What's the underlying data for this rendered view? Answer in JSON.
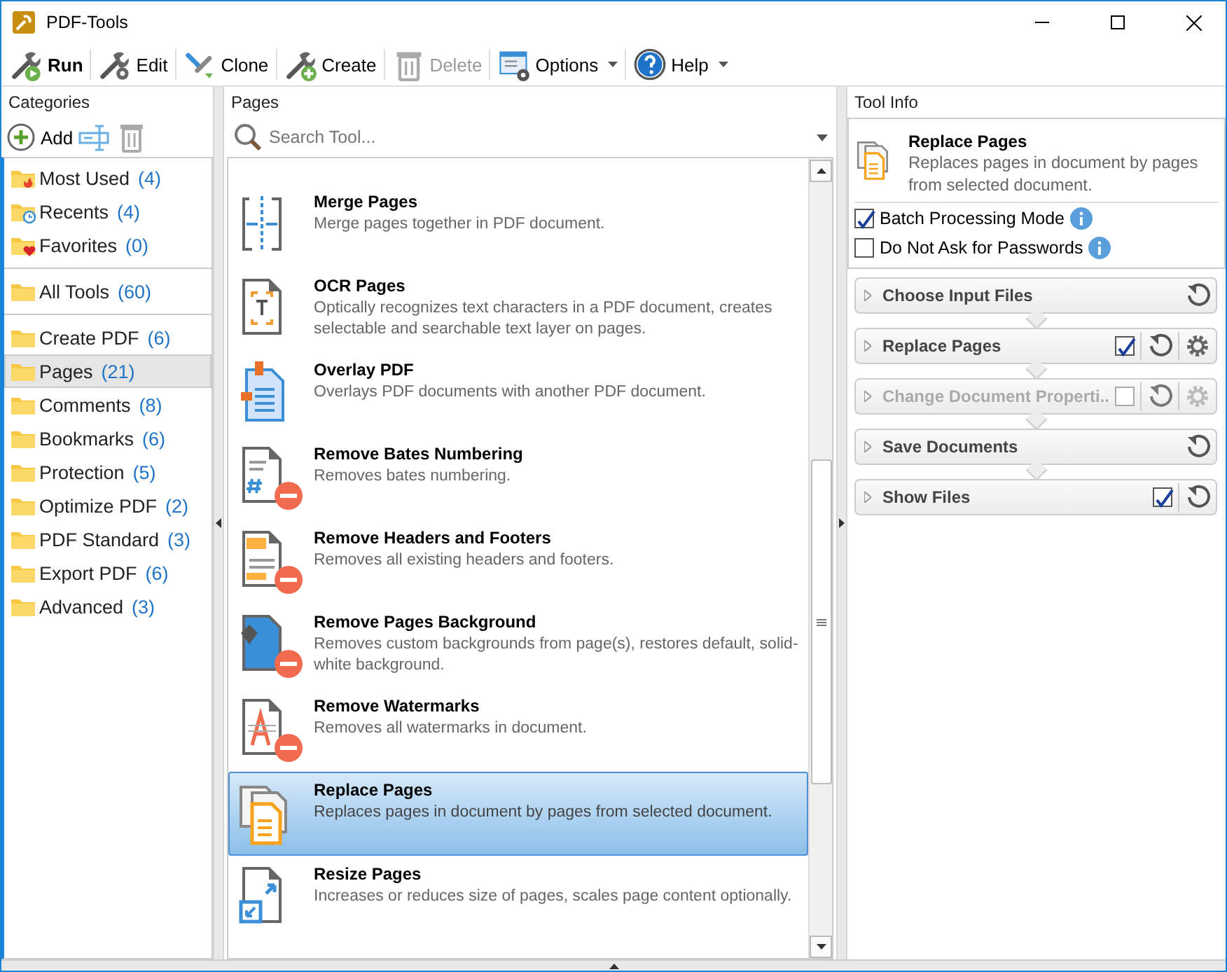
{
  "window": {
    "title": "PDF-Tools"
  },
  "toolbar": [
    {
      "label": "Run",
      "kind": "run",
      "disabled": false,
      "dropdown": false
    },
    {
      "label": "Edit",
      "kind": "edit",
      "disabled": false,
      "dropdown": false
    },
    {
      "label": "Clone",
      "kind": "clone",
      "disabled": false,
      "dropdown": false
    },
    {
      "label": "Create",
      "kind": "create",
      "disabled": false,
      "dropdown": false
    },
    {
      "label": "Delete",
      "kind": "delete",
      "disabled": true,
      "dropdown": false
    },
    {
      "label": "Options",
      "kind": "options",
      "disabled": false,
      "dropdown": true
    },
    {
      "label": "Help",
      "kind": "help",
      "disabled": false,
      "dropdown": true
    }
  ],
  "categories": {
    "title": "Categories",
    "add_label": "Add",
    "groups": [
      [
        {
          "label": "Most Used",
          "count": "(4)",
          "kind": "fire",
          "selected": false
        },
        {
          "label": "Recents",
          "count": "(4)",
          "kind": "clock",
          "selected": false
        },
        {
          "label": "Favorites",
          "count": "(0)",
          "kind": "heart",
          "selected": false
        }
      ],
      [
        {
          "label": "All Tools",
          "count": "(60)",
          "kind": "folder",
          "selected": false
        }
      ],
      [
        {
          "label": "Create PDF",
          "count": "(6)",
          "kind": "folder",
          "selected": false
        },
        {
          "label": "Pages",
          "count": "(21)",
          "kind": "folder",
          "selected": true
        },
        {
          "label": "Comments",
          "count": "(8)",
          "kind": "folder",
          "selected": false
        },
        {
          "label": "Bookmarks",
          "count": "(6)",
          "kind": "folder",
          "selected": false
        },
        {
          "label": "Protection",
          "count": "(5)",
          "kind": "folder",
          "selected": false
        },
        {
          "label": "Optimize PDF",
          "count": "(2)",
          "kind": "folder",
          "selected": false
        },
        {
          "label": "PDF Standard",
          "count": "(3)",
          "kind": "folder",
          "selected": false
        },
        {
          "label": "Export PDF",
          "count": "(6)",
          "kind": "folder",
          "selected": false
        },
        {
          "label": "Advanced",
          "count": "(3)",
          "kind": "folder",
          "selected": false
        }
      ]
    ]
  },
  "pages": {
    "title": "Pages",
    "search": {
      "placeholder": "Search Tool..."
    },
    "tools": [
      {
        "name": "Merge Pages",
        "description": "Merge pages together in PDF document.",
        "selected": false
      },
      {
        "name": "OCR Pages",
        "description": "Optically recognizes text characters in a PDF document, creates selectable and searchable text layer on pages.",
        "selected": false
      },
      {
        "name": "Overlay PDF",
        "description": "Overlays PDF documents with another PDF document.",
        "selected": false
      },
      {
        "name": "Remove Bates Numbering",
        "description": "Removes bates numbering.",
        "selected": false
      },
      {
        "name": "Remove Headers and Footers",
        "description": "Removes all existing headers and footers.",
        "selected": false
      },
      {
        "name": "Remove Pages Background",
        "description": "Removes custom backgrounds from page(s), restores default, solid-white background.",
        "selected": false
      },
      {
        "name": "Remove Watermarks",
        "description": "Removes all watermarks in document.",
        "selected": false
      },
      {
        "name": "Replace Pages",
        "description": "Replaces pages in document by pages from selected document.",
        "selected": true
      },
      {
        "name": "Resize Pages",
        "description": "Increases or reduces size of pages, scales page content optionally.",
        "selected": false
      }
    ]
  },
  "tool_info": {
    "title": "Tool Info",
    "name": "Replace Pages",
    "description": "Replaces pages in document by pages from selected document.",
    "options": [
      {
        "label": "Batch Processing Mode",
        "checked": true
      },
      {
        "label": "Do Not Ask for Passwords",
        "checked": false
      }
    ],
    "steps": [
      {
        "label": "Choose Input Files",
        "kind": "plain",
        "disabled": false
      },
      {
        "label": "Replace Pages",
        "kind": "settings",
        "checked": true,
        "disabled": false
      },
      {
        "label": "Change Document Properti..",
        "kind": "settings",
        "checked": false,
        "disabled": true
      },
      {
        "label": "Save Documents",
        "kind": "plain",
        "disabled": false
      },
      {
        "label": "Show Files",
        "kind": "check",
        "checked": true,
        "disabled": false
      }
    ]
  }
}
